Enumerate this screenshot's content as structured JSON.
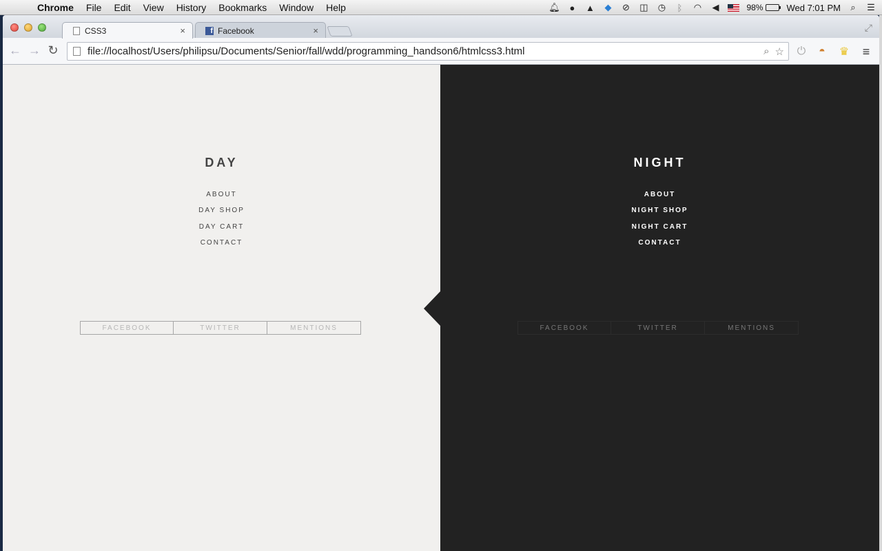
{
  "menubar": {
    "app_name": "Chrome",
    "items": [
      "File",
      "Edit",
      "View",
      "History",
      "Bookmarks",
      "Window",
      "Help"
    ],
    "battery": "98%",
    "clock": "Wed 7:01 PM"
  },
  "tabs": [
    {
      "title": "CSS3",
      "close": "×"
    },
    {
      "title": "Facebook",
      "close": "×"
    }
  ],
  "toolbar": {
    "url": "file://localhost/Users/philipsu/Documents/Senior/fall/wdd/programming_handson6/htmlcss3.html"
  },
  "day": {
    "title": "DAY",
    "nav": [
      "ABOUT",
      "DAY SHOP",
      "DAY CART",
      "CONTACT"
    ],
    "social": [
      "FACEBOOK",
      "TWITTER",
      "MENTIONS"
    ],
    "background": "#f1f0ee"
  },
  "night": {
    "title": "NIGHT",
    "nav": [
      "ABOUT",
      "NIGHT SHOP",
      "NIGHT CART",
      "CONTACT"
    ],
    "social": [
      "FACEBOOK",
      "TWITTER",
      "MENTIONS"
    ],
    "background": "#222222"
  }
}
